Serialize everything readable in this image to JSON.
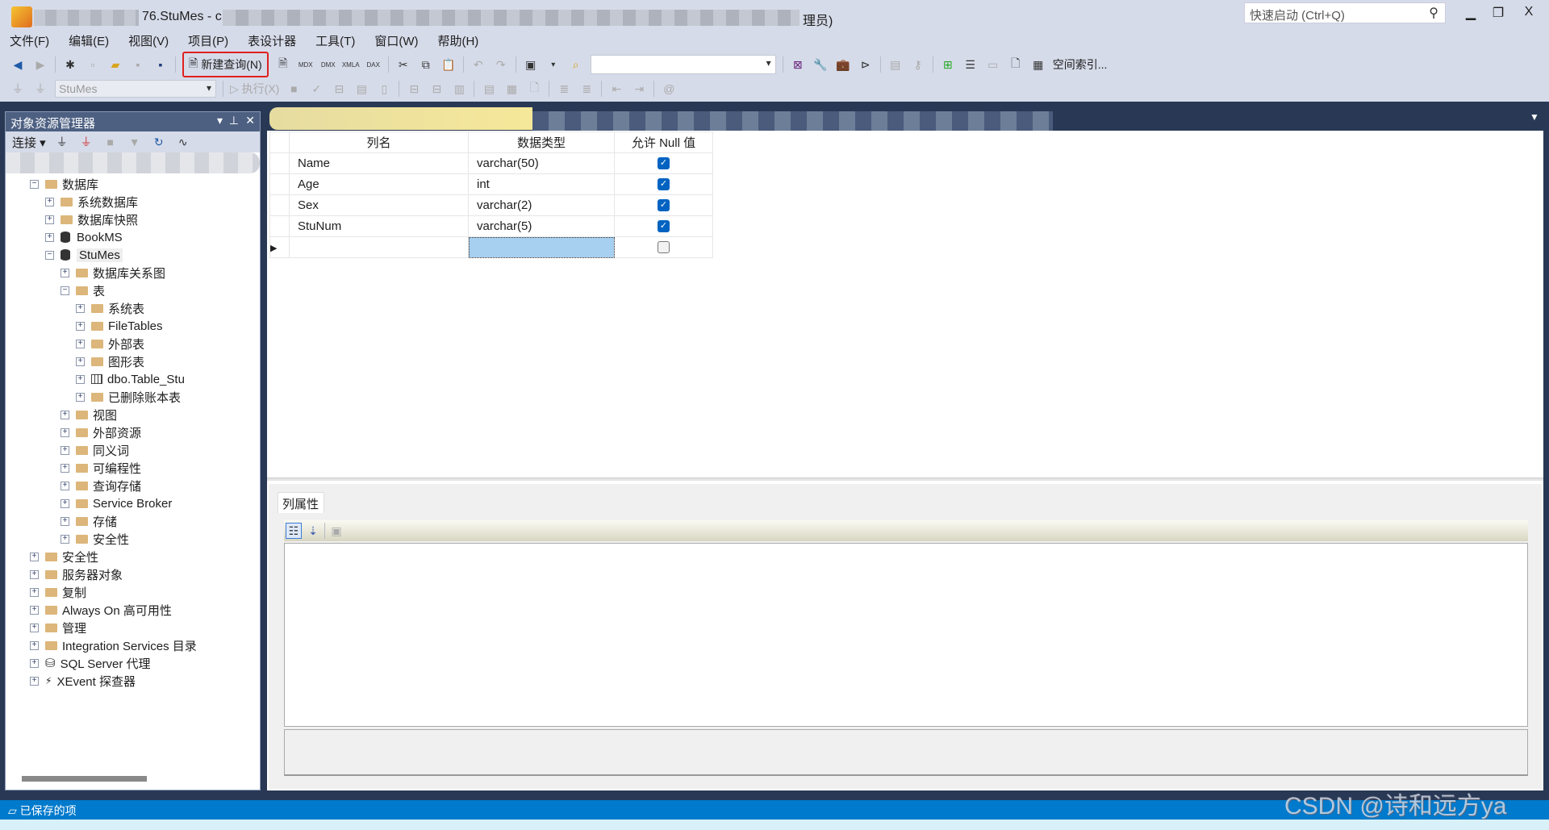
{
  "window": {
    "title_visible": "76.StuMes - c",
    "title_suffix": "理员)",
    "quick_launch_placeholder": "快速启动 (Ctrl+Q)",
    "minimize": "▁",
    "restore": "❐",
    "close": "X"
  },
  "menu": [
    "文件(F)",
    "编辑(E)",
    "视图(V)",
    "项目(P)",
    "表设计器",
    "工具(T)",
    "窗口(W)",
    "帮助(H)"
  ],
  "toolbar": {
    "new_query": "新建查询(N)",
    "mdx": "MDX",
    "dmx": "DMX",
    "xmla": "XMLA",
    "dax": "DAX",
    "spatial_index": "空间索引...",
    "database": "StuMes",
    "execute": "执行(X)"
  },
  "object_explorer": {
    "title": "对象资源管理器",
    "connect": "连接",
    "tree": [
      {
        "label": "数据库",
        "level": 0,
        "state": "-",
        "icon": "folder"
      },
      {
        "label": "系统数据库",
        "level": 1,
        "state": "+",
        "icon": "folder"
      },
      {
        "label": "数据库快照",
        "level": 1,
        "state": "+",
        "icon": "folder"
      },
      {
        "label": "BookMS",
        "level": 1,
        "state": "+",
        "icon": "database"
      },
      {
        "label": "StuMes",
        "level": 1,
        "state": "-",
        "icon": "database"
      },
      {
        "label": "数据库关系图",
        "level": 2,
        "state": "+",
        "icon": "folder"
      },
      {
        "label": "表",
        "level": 2,
        "state": "-",
        "icon": "folder"
      },
      {
        "label": "系统表",
        "level": 3,
        "state": "+",
        "icon": "folder"
      },
      {
        "label": "FileTables",
        "level": 3,
        "state": "+",
        "icon": "folder"
      },
      {
        "label": "外部表",
        "level": 3,
        "state": "+",
        "icon": "folder"
      },
      {
        "label": "图形表",
        "level": 3,
        "state": "+",
        "icon": "folder"
      },
      {
        "label": "dbo.Table_Stu",
        "level": 3,
        "state": "+",
        "icon": "table"
      },
      {
        "label": "已删除账本表",
        "level": 3,
        "state": "+",
        "icon": "folder"
      },
      {
        "label": "视图",
        "level": 2,
        "state": "+",
        "icon": "folder"
      },
      {
        "label": "外部资源",
        "level": 2,
        "state": "+",
        "icon": "folder"
      },
      {
        "label": "同义词",
        "level": 2,
        "state": "+",
        "icon": "folder"
      },
      {
        "label": "可编程性",
        "level": 2,
        "state": "+",
        "icon": "folder"
      },
      {
        "label": "查询存储",
        "level": 2,
        "state": "+",
        "icon": "folder"
      },
      {
        "label": "Service Broker",
        "level": 2,
        "state": "+",
        "icon": "folder"
      },
      {
        "label": "存储",
        "level": 2,
        "state": "+",
        "icon": "folder"
      },
      {
        "label": "安全性",
        "level": 2,
        "state": "+",
        "icon": "folder"
      },
      {
        "label": "安全性",
        "level": 0,
        "state": "+",
        "icon": "folder"
      },
      {
        "label": "服务器对象",
        "level": 0,
        "state": "+",
        "icon": "folder"
      },
      {
        "label": "复制",
        "level": 0,
        "state": "+",
        "icon": "folder"
      },
      {
        "label": "Always On 高可用性",
        "level": 0,
        "state": "+",
        "icon": "folder"
      },
      {
        "label": "管理",
        "level": 0,
        "state": "+",
        "icon": "folder"
      },
      {
        "label": "Integration Services 目录",
        "level": 0,
        "state": "+",
        "icon": "folder"
      },
      {
        "label": "SQL Server 代理",
        "level": 0,
        "state": "+",
        "icon": "agent"
      },
      {
        "label": "XEvent 探查器",
        "level": 0,
        "state": "+",
        "icon": "xevent"
      }
    ]
  },
  "designer": {
    "headers": [
      "列名",
      "数据类型",
      "允许 Null 值"
    ],
    "rows": [
      {
        "name": "Name",
        "type": "varchar(50)",
        "nullable": true
      },
      {
        "name": "Age",
        "type": "int",
        "nullable": true
      },
      {
        "name": "Sex",
        "type": "varchar(2)",
        "nullable": true
      },
      {
        "name": "StuNum",
        "type": "varchar(5)",
        "nullable": true
      },
      {
        "name": "",
        "type": "",
        "nullable": false
      }
    ]
  },
  "properties": {
    "tab": "列属性"
  },
  "status": {
    "text": "已保存的项"
  },
  "watermark": "CSDN @诗和远方ya",
  "colors": {
    "status_bar": "#007acc",
    "panel_header": "#4d6082",
    "dark_bg": "#293955",
    "highlight_box": "#e02020"
  }
}
